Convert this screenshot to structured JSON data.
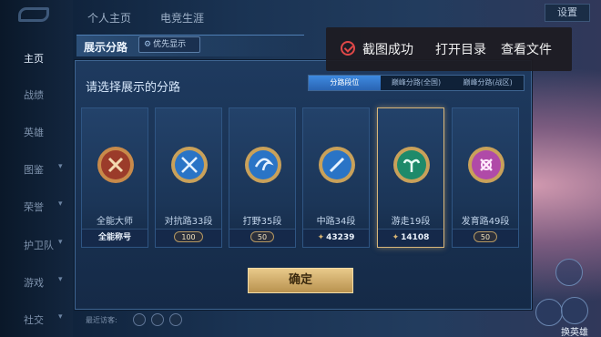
{
  "top_tabs": [
    "个人主页",
    "电竞生涯"
  ],
  "settings_label": "设置",
  "sidebar": {
    "items": [
      {
        "label": "主页",
        "active": true,
        "chevron": false
      },
      {
        "label": "战绩",
        "active": false,
        "chevron": false
      },
      {
        "label": "英雄",
        "active": false,
        "chevron": false
      },
      {
        "label": "图鉴",
        "active": false,
        "chevron": true
      },
      {
        "label": "荣誉",
        "active": false,
        "chevron": true
      },
      {
        "label": "护卫队",
        "active": false,
        "chevron": true
      },
      {
        "label": "游戏",
        "active": false,
        "chevron": true
      },
      {
        "label": "社交",
        "active": false,
        "chevron": true
      }
    ]
  },
  "right_buttons": {
    "label": "换英雄"
  },
  "dialog": {
    "title": "展示分路",
    "priority_label": "优先显示",
    "subtitle": "请选择展示的分路",
    "filters": [
      {
        "label": "分路段位",
        "active": true
      },
      {
        "label": "巅峰分路(全国)",
        "active": false
      },
      {
        "label": "巅峰分路(战区)",
        "active": false
      }
    ],
    "cards": [
      {
        "name": "全能大师",
        "footer": "全能称号",
        "footer_type": "text",
        "emblem": "allround",
        "selected": false
      },
      {
        "name": "对抗路33段",
        "footer": "100",
        "footer_type": "pill",
        "emblem": "clash",
        "selected": false
      },
      {
        "name": "打野35段",
        "footer": "50",
        "footer_type": "pill",
        "emblem": "jungle",
        "selected": false
      },
      {
        "name": "中路34段",
        "footer": "43239",
        "footer_type": "peak",
        "emblem": "mid",
        "selected": false
      },
      {
        "name": "游走19段",
        "footer": "14108",
        "footer_type": "peak",
        "emblem": "roam",
        "selected": true
      },
      {
        "name": "发育路49段",
        "footer": "50",
        "footer_type": "pill",
        "emblem": "farm",
        "selected": false
      }
    ],
    "confirm_label": "确定"
  },
  "footer_label": "最近访客:",
  "toast": {
    "success_text": "截图成功",
    "open_dir": "打开目录",
    "view_file": "查看文件"
  },
  "colors": {
    "accent_gold": "#d9b77a",
    "confirm_gold": "#e8c98a",
    "filter_active": "#3e8ae0",
    "toast_check": "#e04848"
  }
}
